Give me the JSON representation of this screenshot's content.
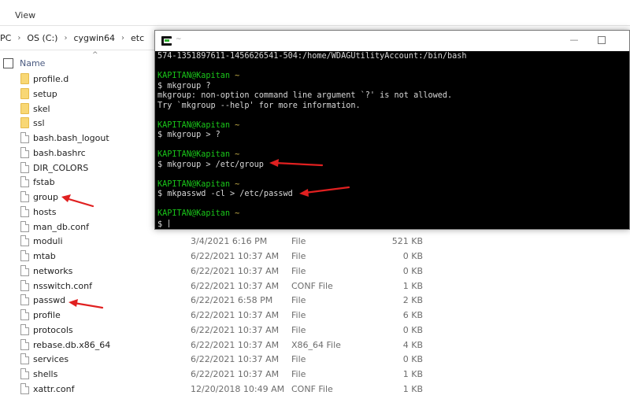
{
  "explorer": {
    "ribbon": {
      "view_tab": "View"
    },
    "breadcrumb": [
      "PC",
      "OS (C:)",
      "cygwin64",
      "etc"
    ],
    "columns": {
      "name": "Name"
    },
    "files": [
      {
        "name": "profile.d",
        "kind": "folder",
        "date": "",
        "type": "",
        "size": ""
      },
      {
        "name": "setup",
        "kind": "folder",
        "date": "",
        "type": "",
        "size": ""
      },
      {
        "name": "skel",
        "kind": "folder",
        "date": "",
        "type": "",
        "size": ""
      },
      {
        "name": "ssl",
        "kind": "folder",
        "date": "",
        "type": "",
        "size": ""
      },
      {
        "name": "bash.bash_logout",
        "kind": "file",
        "date": "",
        "type": "",
        "size": ""
      },
      {
        "name": "bash.bashrc",
        "kind": "file",
        "date": "",
        "type": "",
        "size": ""
      },
      {
        "name": "DIR_COLORS",
        "kind": "file",
        "date": "",
        "type": "",
        "size": ""
      },
      {
        "name": "fstab",
        "kind": "file",
        "date": "",
        "type": "",
        "size": ""
      },
      {
        "name": "group",
        "kind": "file",
        "date": "",
        "type": "",
        "size": ""
      },
      {
        "name": "hosts",
        "kind": "file",
        "date": "",
        "type": "",
        "size": ""
      },
      {
        "name": "man_db.conf",
        "kind": "file",
        "date": "",
        "type": "",
        "size": ""
      },
      {
        "name": "moduli",
        "kind": "file",
        "date": "3/4/2021 6:16 PM",
        "type": "File",
        "size": "521 KB"
      },
      {
        "name": "mtab",
        "kind": "file",
        "date": "6/22/2021 10:37 AM",
        "type": "File",
        "size": "0 KB"
      },
      {
        "name": "networks",
        "kind": "file",
        "date": "6/22/2021 10:37 AM",
        "type": "File",
        "size": "0 KB"
      },
      {
        "name": "nsswitch.conf",
        "kind": "file",
        "date": "6/22/2021 10:37 AM",
        "type": "CONF File",
        "size": "1 KB"
      },
      {
        "name": "passwd",
        "kind": "file",
        "date": "6/22/2021 6:58 PM",
        "type": "File",
        "size": "2 KB"
      },
      {
        "name": "profile",
        "kind": "file",
        "date": "6/22/2021 10:37 AM",
        "type": "File",
        "size": "6 KB"
      },
      {
        "name": "protocols",
        "kind": "file",
        "date": "6/22/2021 10:37 AM",
        "type": "File",
        "size": "0 KB"
      },
      {
        "name": "rebase.db.x86_64",
        "kind": "file",
        "date": "6/22/2021 10:37 AM",
        "type": "X86_64 File",
        "size": "4 KB"
      },
      {
        "name": "services",
        "kind": "file",
        "date": "6/22/2021 10:37 AM",
        "type": "File",
        "size": "0 KB"
      },
      {
        "name": "shells",
        "kind": "file",
        "date": "6/22/2021 10:37 AM",
        "type": "File",
        "size": "1 KB"
      },
      {
        "name": "xattr.conf",
        "kind": "file",
        "date": "12/20/2018 10:49 AM",
        "type": "CONF File",
        "size": "1 KB"
      }
    ]
  },
  "terminal": {
    "title": "~",
    "lines": [
      {
        "kind": "output",
        "text": "574-1351897611-1456626541-504:/home/WDAGUtilityAccount:/bin/bash"
      },
      {
        "kind": "blank",
        "text": ""
      },
      {
        "kind": "prompt",
        "user": "KAPITAN@Kapitan",
        "dir": "~"
      },
      {
        "kind": "command",
        "text": "$ mkgroup ?"
      },
      {
        "kind": "output",
        "text": "mkgroup: non-option command line argument `?' is not allowed."
      },
      {
        "kind": "output",
        "text": "Try `mkgroup --help' for more information."
      },
      {
        "kind": "blank",
        "text": ""
      },
      {
        "kind": "prompt",
        "user": "KAPITAN@Kapitan",
        "dir": "~"
      },
      {
        "kind": "command",
        "text": "$ mkgroup > ?"
      },
      {
        "kind": "blank",
        "text": ""
      },
      {
        "kind": "prompt",
        "user": "KAPITAN@Kapitan",
        "dir": "~"
      },
      {
        "kind": "command",
        "text": "$ mkgroup > /etc/group"
      },
      {
        "kind": "blank",
        "text": ""
      },
      {
        "kind": "prompt",
        "user": "KAPITAN@Kapitan",
        "dir": "~"
      },
      {
        "kind": "command",
        "text": "$ mkpasswd -cl > /etc/passwd"
      },
      {
        "kind": "blank",
        "text": ""
      },
      {
        "kind": "prompt",
        "user": "KAPITAN@Kapitan",
        "dir": "~"
      },
      {
        "kind": "input",
        "text": "$ "
      }
    ]
  },
  "colors": {
    "prompt_user": "#19c619",
    "prompt_dir": "#c8b24a",
    "terminal_bg": "#000000",
    "annotation_arrow": "#e02020",
    "folder": "#f8d775"
  }
}
